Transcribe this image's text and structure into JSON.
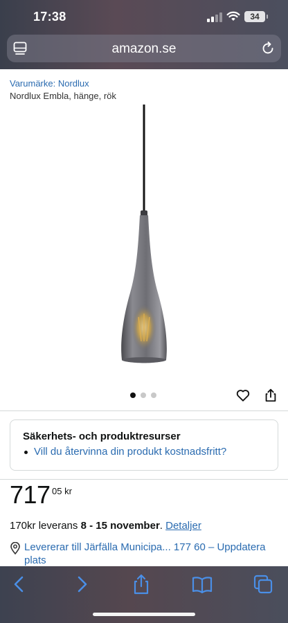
{
  "status_bar": {
    "time": "17:38",
    "battery": "34",
    "icons": [
      "signal-icon",
      "wifi-icon",
      "battery-icon"
    ]
  },
  "browser": {
    "url": "amazon.se",
    "left_icon": "tabs-list-icon",
    "right_icon": "reload-icon"
  },
  "product": {
    "brand": "Varumärke: Nordlux",
    "name": "Nordlux Embla, hänge, rök",
    "image": "pendant-lamp-image",
    "gallery_count": 3,
    "gallery_active": 0
  },
  "actions": {
    "favorite_icon": "heart-icon",
    "share_icon": "share-icon"
  },
  "safety": {
    "title": "Säkerhets- och produktresurser",
    "link": "Vill du återvinna din produkt kostnadsfritt?"
  },
  "price": {
    "whole": "717",
    "fraction": "05 kr"
  },
  "delivery": {
    "prefix": "170kr leverans ",
    "dates": "8 - 15 november",
    "suffix": ". ",
    "details_link": "Detaljer"
  },
  "location": {
    "text": "Levererar till Järfälla Municipa... 177 60 – Uppdatera plats"
  },
  "toolbar": {
    "items": [
      "back-icon",
      "forward-icon",
      "share-icon",
      "bookmarks-icon",
      "tabs-icon"
    ]
  },
  "colors": {
    "link": "#2a6bb0",
    "text": "#0f1111",
    "toolbar_icon": "#4a8fe7"
  }
}
